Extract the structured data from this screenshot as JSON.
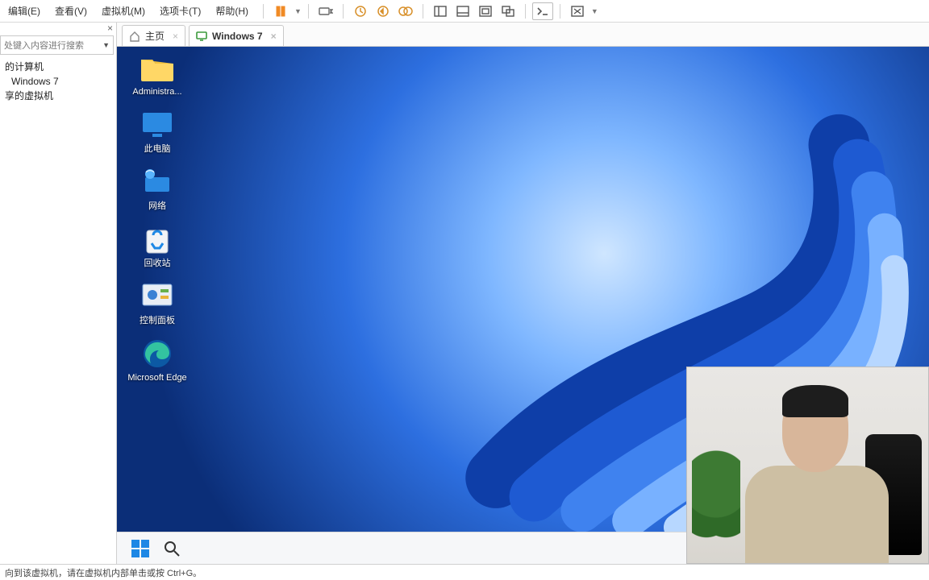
{
  "menu": {
    "edit": "编辑(E)",
    "view": "查看(V)",
    "vm": "虚拟机(M)",
    "tabs": "选项卡(T)",
    "help": "帮助(H)"
  },
  "sidebar": {
    "close_tooltip": "关闭",
    "search_placeholder": "处键入内容进行搜索",
    "items": [
      "的计算机",
      "Windows 7",
      "享的虚拟机"
    ]
  },
  "tabs": {
    "home": "主页",
    "vm": "Windows 7"
  },
  "desktop": {
    "icons": [
      {
        "label": "Administra..."
      },
      {
        "label": "此电脑"
      },
      {
        "label": "网络"
      },
      {
        "label": "回收站"
      },
      {
        "label": "控制面板"
      },
      {
        "label": "Microsoft Edge"
      }
    ]
  },
  "statusbar": "向到该虚拟机，请在虚拟机内部单击或按 Ctrl+G。"
}
